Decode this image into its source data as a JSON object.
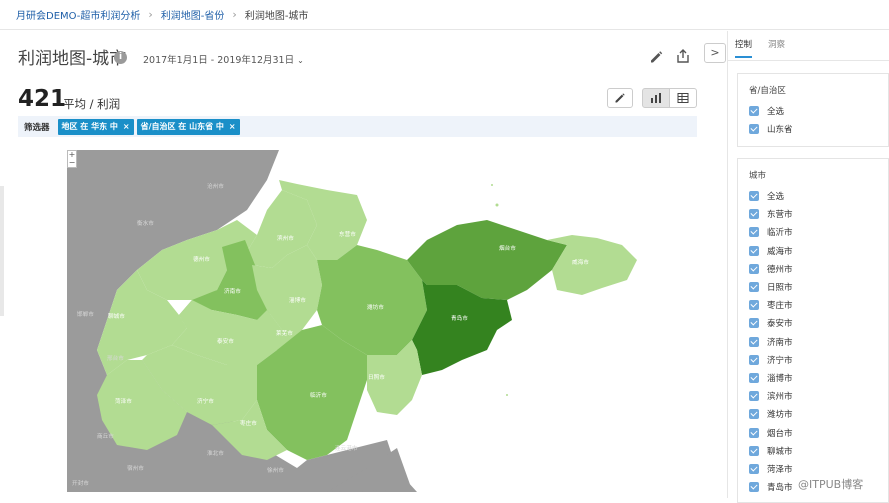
{
  "breadcrumb": {
    "items": [
      {
        "label": "月研会DEMO-超市利润分析"
      },
      {
        "label": "利润地图-省份"
      },
      {
        "label": "利润地图-城市"
      }
    ]
  },
  "header": {
    "title": "利润地图-城市",
    "info_icon": "i",
    "date_range": "2017年1月1日 - 2019年12月31日",
    "collapse_label": ">"
  },
  "kpi": {
    "value": "421",
    "label": "平均 / 利润"
  },
  "filters": {
    "label": "筛选器",
    "chips": [
      {
        "text": "地区 在 华东 中",
        "close": "×"
      },
      {
        "text": "省/自治区 在 山东省 中",
        "close": "×"
      }
    ]
  },
  "map": {
    "zoom_in": "+",
    "zoom_out": "−",
    "colors": {
      "light": "#b2dc92",
      "mid": "#83c15e",
      "dark": "#5ea33d",
      "darkest": "#34831f",
      "bg": "#9b9b9b",
      "sea": "#ffffff"
    },
    "cities": [
      "烟台市",
      "威海市",
      "青岛市",
      "潍坊市",
      "东营市",
      "滨州市",
      "德州市",
      "济南市",
      "淄博市",
      "泰安市",
      "聊城市",
      "济宁市",
      "菏泽市",
      "枣庄市",
      "临沂市",
      "日照市",
      "莱芜市"
    ],
    "outside": [
      "沧州市",
      "衡水市",
      "邯郸市",
      "邢台市",
      "宿州市",
      "商丘市",
      "徐州市",
      "连云港市",
      "淮北市",
      "开封市"
    ]
  },
  "panel": {
    "tabs": [
      {
        "label": "控制"
      },
      {
        "label": "洞察"
      }
    ],
    "province_card": {
      "title": "省/自治区",
      "options": [
        "全选",
        "山东省"
      ]
    },
    "city_card": {
      "title": "城市",
      "options": [
        "全选",
        "东营市",
        "临沂市",
        "威海市",
        "德州市",
        "日照市",
        "枣庄市",
        "泰安市",
        "济南市",
        "济宁市",
        "淄博市",
        "滨州市",
        "潍坊市",
        "烟台市",
        "聊城市",
        "菏泽市",
        "青岛市"
      ]
    }
  },
  "watermark": "@ITPUB博客"
}
